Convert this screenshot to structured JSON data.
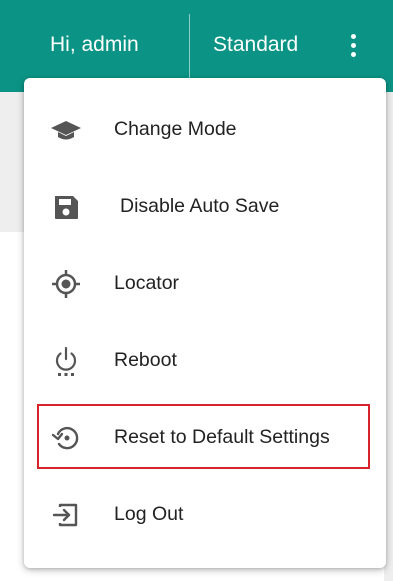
{
  "header": {
    "greeting": "Hi, admin",
    "mode": "Standard",
    "more_icon": "more-vert-icon",
    "background_color": "#0b9485"
  },
  "menu": {
    "items": [
      {
        "label": "Change Mode",
        "icon": "graduation-cap-icon"
      },
      {
        "label": "Disable Auto Save",
        "icon": "floppy-disk-icon"
      },
      {
        "label": "Locator",
        "icon": "crosshair-icon"
      },
      {
        "label": "Reboot",
        "icon": "power-icon"
      },
      {
        "label": "Reset to Default Settings",
        "icon": "restore-icon",
        "highlighted": true
      },
      {
        "label": "Log Out",
        "icon": "logout-icon"
      }
    ],
    "highlight_color": "#d7232b",
    "icon_color": "#555555"
  }
}
